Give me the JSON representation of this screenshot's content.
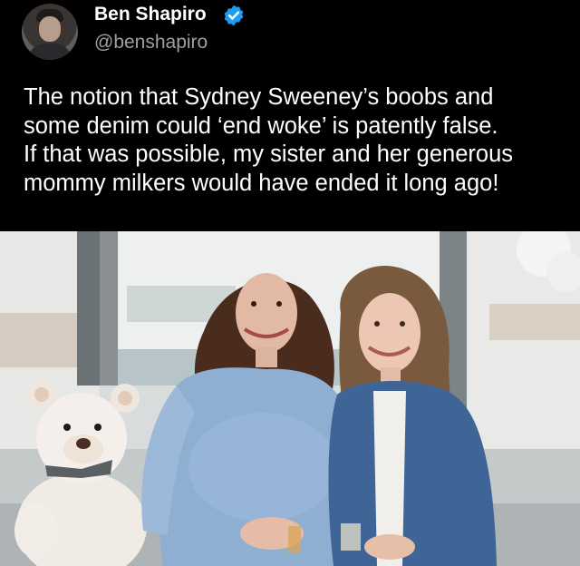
{
  "post": {
    "display_name": "Ben Shapiro",
    "handle": "@benshapiro",
    "text_lines": [
      "The notion that Sydney Sweeney’s boobs and",
      "some denim could ‘end woke’ is patently false.",
      "If that was possible, my sister and her generous",
      "mommy milkers would have ended it long ago!"
    ],
    "verified_icon": "verified-badge-icon",
    "accent_color": "#1d9bf0"
  },
  "photo": {
    "subject_icons": [
      "teddy-bear",
      "woman-left",
      "woman-right"
    ]
  }
}
